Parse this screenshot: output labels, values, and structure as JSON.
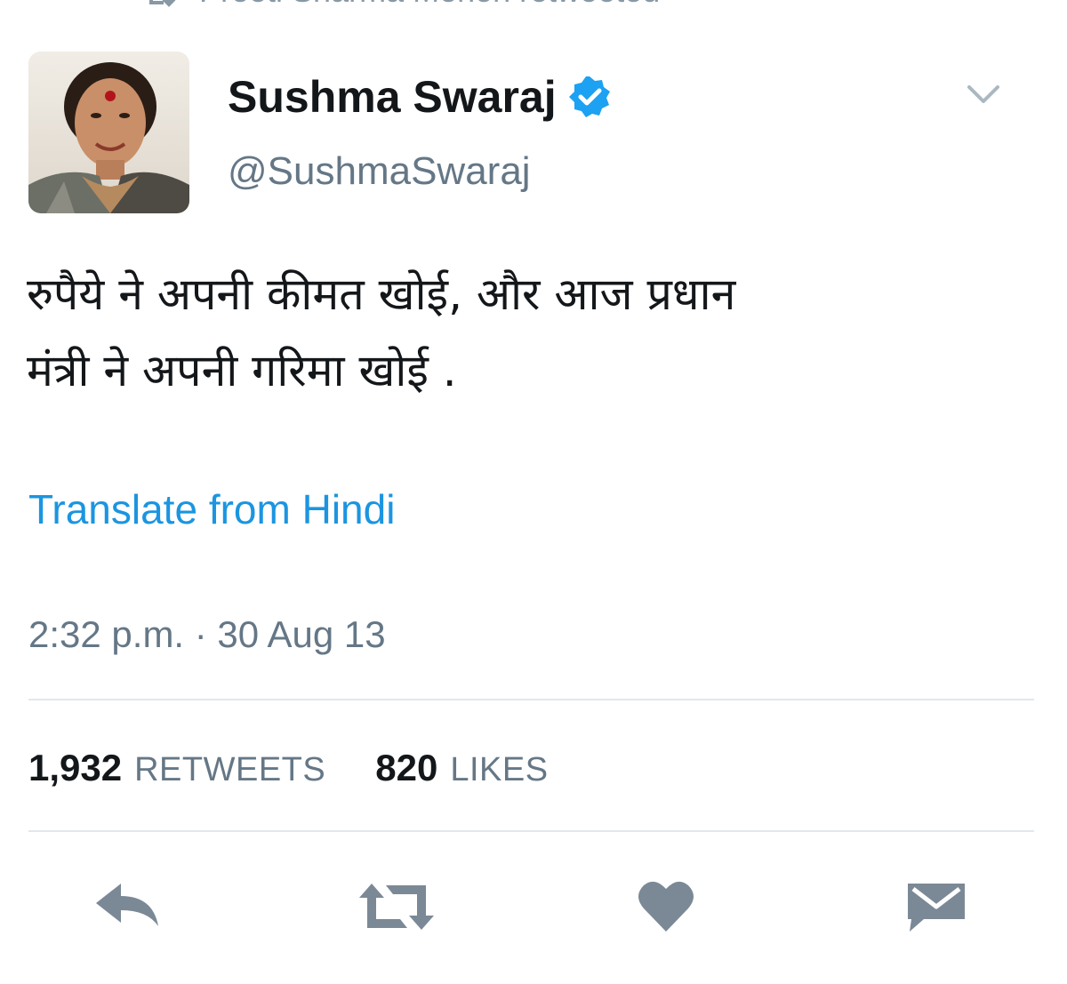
{
  "retweet_context": {
    "text": "Preeti Sharma Menon retweeted"
  },
  "author": {
    "display_name": "Sushma Swaraj",
    "handle": "@SushmaSwaraj",
    "verified": true
  },
  "tweet": {
    "text_lines": [
      "रुपैये ने अपनी कीमत खोई, और आज प्रधान",
      "मंत्री ने अपनी गरिमा खोई ."
    ],
    "translate_label": "Translate from Hindi",
    "timestamp": "2:32 p.m. · 30 Aug 13"
  },
  "stats": {
    "retweets_count": "1,932",
    "retweets_label": "RETWEETS",
    "likes_count": "820",
    "likes_label": "LIKES"
  },
  "icons": {
    "retweet_context": "retweet-icon",
    "verified": "verified-badge-icon",
    "menu": "chevron-down-icon",
    "reply": "reply-icon",
    "retweet": "retweet-icon",
    "like": "heart-icon",
    "dm": "envelope-icon"
  },
  "colors": {
    "link": "#1b95e0",
    "verified": "#1da1f2",
    "secondary_text": "#657786",
    "action_icon": "#7b8996",
    "divider": "#e1e8ed"
  }
}
